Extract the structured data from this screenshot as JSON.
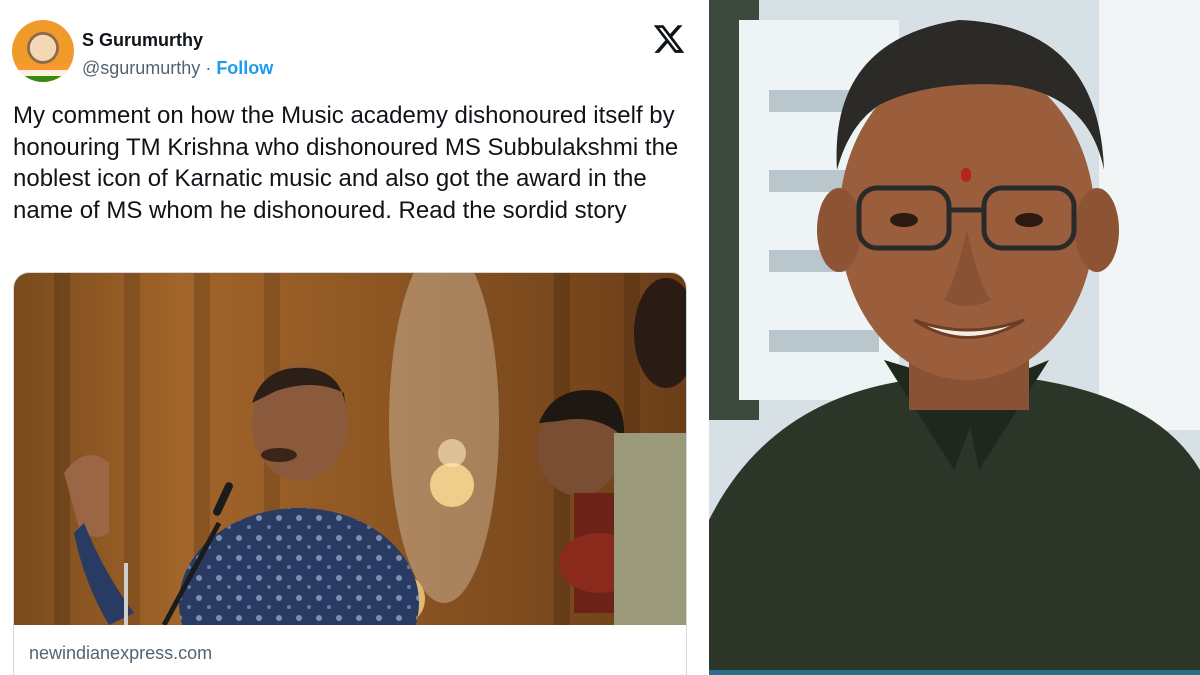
{
  "tweet": {
    "author_name": "S Gurumurthy",
    "handle": "@sgurumurthy",
    "separator": " · ",
    "follow_label": "Follow",
    "text": "My comment on how the Music academy dishonoured itself by honouring TM Krishna who dishonoured MS Subbulakshmi the noblest icon of Karnatic music and also got the award in the name of MS whom he dishonoured. Read the sordid story",
    "card": {
      "domain": "newindianexpress.com",
      "image_icon": "photo-of-musician-performing-on-stage"
    },
    "logo_icon": "x-logo-icon"
  },
  "right_photo": {
    "icon": "portrait-photo-of-man-in-glasses"
  },
  "colors": {
    "link_blue": "#1d9bf0",
    "text_primary": "#0f1419",
    "text_secondary": "#536471"
  }
}
